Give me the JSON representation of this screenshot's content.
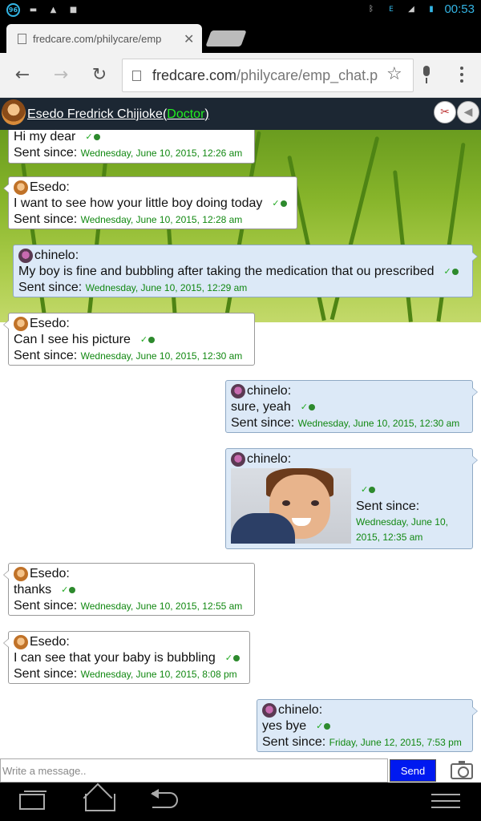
{
  "status_bar": {
    "time": "00:53",
    "badge": "96",
    "network": "E"
  },
  "tab": {
    "title": "fredcare.com/philycare/emp"
  },
  "omnibox": {
    "domain": "fredcare.com",
    "path": "/philycare/emp_chat.p"
  },
  "chat_header": {
    "name": "Esedo Fredrick Chijioke",
    "open_paren": "(",
    "role": "Doctor",
    "close_paren": ")"
  },
  "sent_label": "Sent since:",
  "messages": [
    {
      "sender": "",
      "text": "Hi my dear",
      "time": "Wednesday, June 10, 2015, 12:26 am"
    },
    {
      "sender": "Esedo:",
      "text": "I want to see how your little boy doing today",
      "time": "Wednesday, June 10, 2015, 12:28 am"
    },
    {
      "sender": "chinelo:",
      "text": "My boy is fine and bubbling after taking the medication that ou prescribed",
      "time": "Wednesday, June 10, 2015, 12:29 am"
    },
    {
      "sender": "Esedo:",
      "text": "Can I see his picture",
      "time": "Wednesday, June 10, 2015, 12:30 am"
    },
    {
      "sender": "chinelo:",
      "text": "sure, yeah",
      "time": "Wednesday, June 10, 2015, 12:30 am"
    },
    {
      "sender": "chinelo:",
      "text": "",
      "time_line1": "Wednesday, June 10,",
      "time_line2": "2015, 12:35 am"
    },
    {
      "sender": "Esedo:",
      "text": "thanks",
      "time": "Wednesday, June 10, 2015, 12:55 am"
    },
    {
      "sender": "Esedo:",
      "text": "I can see that your baby is bubbling",
      "time": "Wednesday, June 10, 2015, 8:08 pm"
    },
    {
      "sender": "chinelo:",
      "text": "yes bye",
      "time": "Friday, June 12, 2015, 7:53 pm"
    }
  ],
  "composer": {
    "placeholder": "Write a message..",
    "send_label": "Send"
  },
  "colors": {
    "chat_header_bg": "#1c2733",
    "role_green": "#22ee22",
    "timestamp_green": "#118811",
    "send_blue": "#0019f0",
    "outgoing_bubble": "#dce9f7"
  }
}
